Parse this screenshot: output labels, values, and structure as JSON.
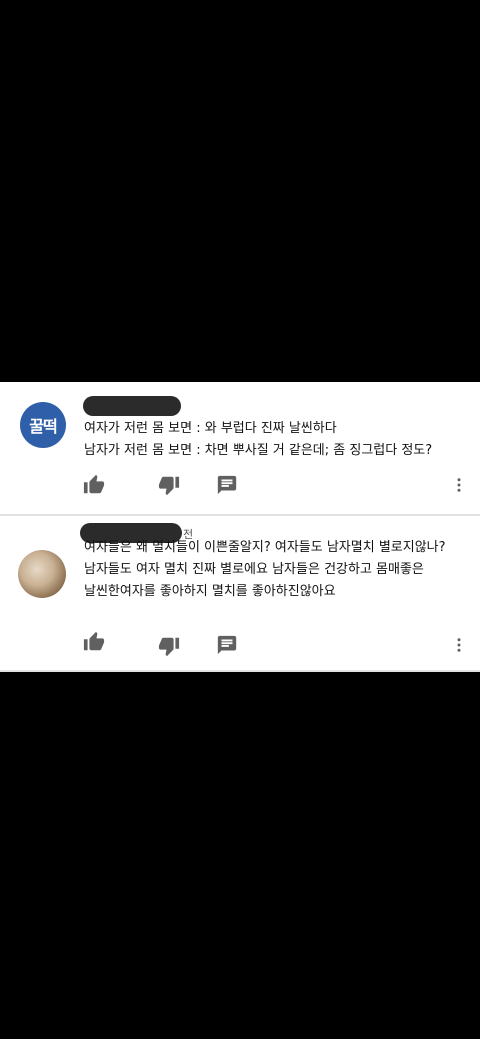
{
  "comments": [
    {
      "author_initials": "꿀떡",
      "lines": [
        "여자가 저런 몸 보면 : 와 부럽다 진짜 날씬하다",
        "남자가 저런 몸 보면 : 차면 뿌사질 거 같은데; 좀 징그럽다 정도?"
      ]
    },
    {
      "timestamp_partial": "전",
      "lines": [
        "여자들은 왜 멸치들이 이쁜줄알지? 여자들도 남자멸치 별로지않나?",
        "남자들도 여자 멸치 진짜 별로에요 남자들은 건강하고 몸매좋은",
        "날씬한여자를 좋아하지 멸치를 좋아하진않아요"
      ]
    }
  ],
  "colors": {
    "background": "#000000",
    "panel": "#ffffff",
    "avatar_blue": "#2f5fa8",
    "icon": "#606060"
  },
  "icons": [
    "thumbs-up-icon",
    "thumbs-down-icon",
    "reply-icon",
    "more-vert-icon"
  ]
}
